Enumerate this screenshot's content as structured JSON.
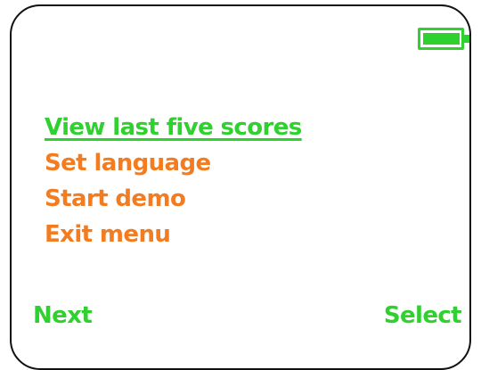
{
  "colors": {
    "accent_green": "#2fd12f",
    "menu_orange": "#f47c20",
    "bezel": "#111111"
  },
  "status": {
    "battery_icon": "battery-icon",
    "battery_level": 0.9
  },
  "menu": {
    "selected_index": 0,
    "items": [
      {
        "label": "View last five scores"
      },
      {
        "label": "Set language"
      },
      {
        "label": "Start demo"
      },
      {
        "label": "Exit menu"
      }
    ]
  },
  "softkeys": {
    "left_label": "Next",
    "right_label": "Select"
  }
}
